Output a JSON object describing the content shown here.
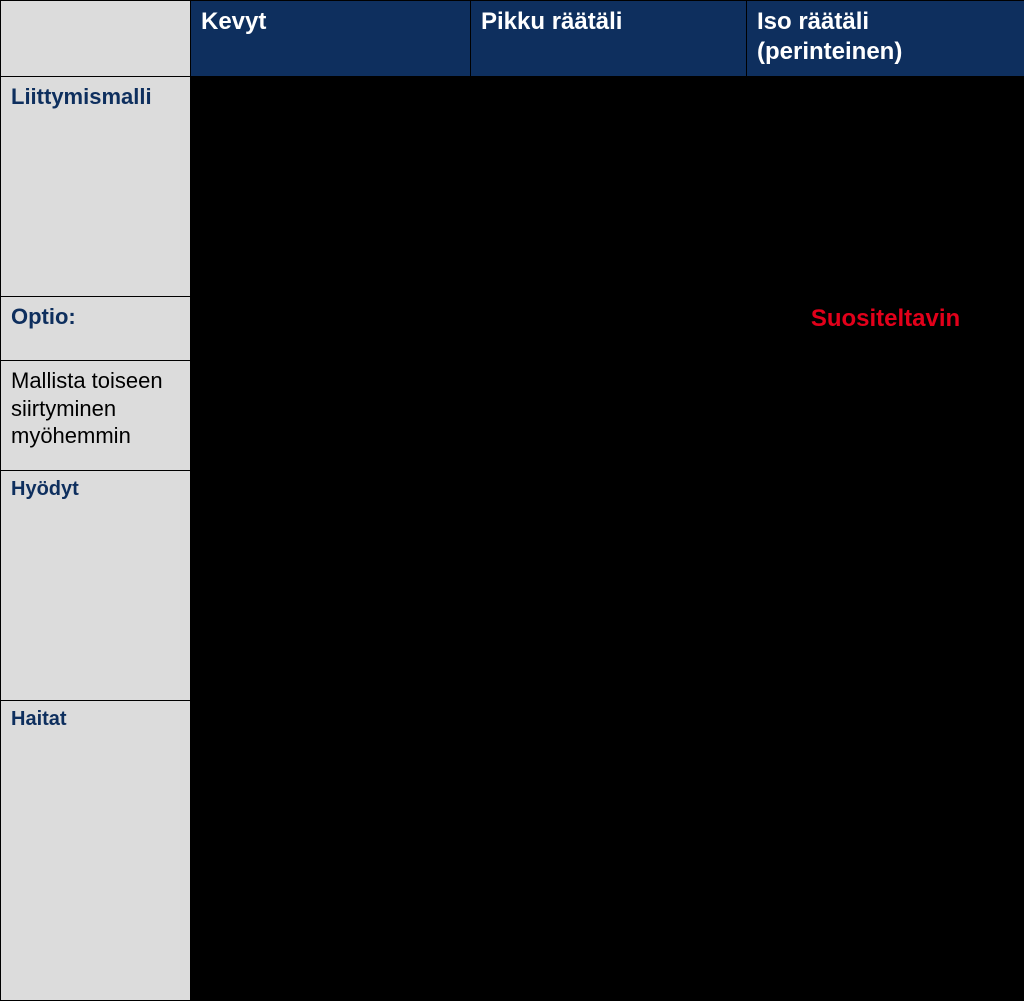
{
  "headers": {
    "blank": "",
    "col1": "Kevyt",
    "col2": "Pikku räätäli",
    "col3": "Iso räätäli (perinteinen)"
  },
  "rows": {
    "liittymismalli": {
      "label": "Liittymismalli"
    },
    "optio": {
      "label": "Optio:",
      "recommend": "Suositeltavin"
    },
    "mallista": {
      "label": "Mallista toiseen siirtyminen myöhemmin"
    },
    "hyodyt": {
      "label": "Hyödyt"
    },
    "haitat": {
      "label": "Haitat"
    }
  }
}
